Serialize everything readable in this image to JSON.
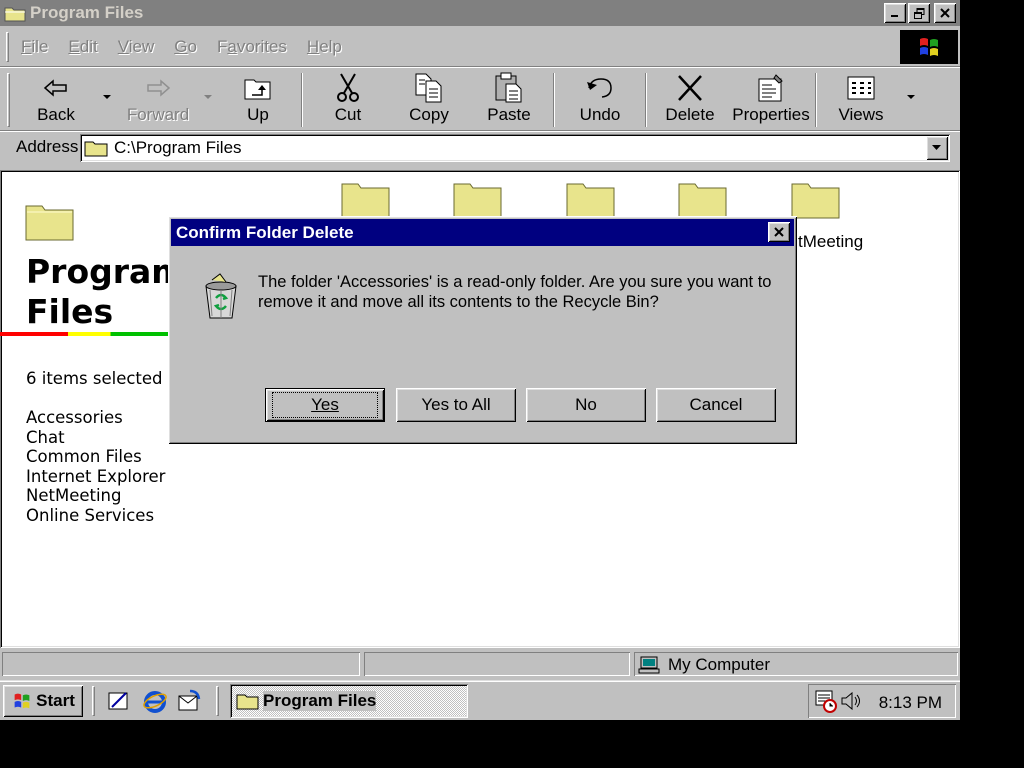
{
  "window": {
    "title": "Program Files"
  },
  "menu": [
    {
      "label": "File",
      "key": "F",
      "rest": "ile"
    },
    {
      "label": "Edit",
      "key": "E",
      "rest": "dit"
    },
    {
      "label": "View",
      "key": "V",
      "rest": "iew"
    },
    {
      "label": "Go",
      "key": "G",
      "rest": "o"
    },
    {
      "label": "Favorites",
      "key": "a",
      "pre": "F",
      "rest": "vorites"
    },
    {
      "label": "Help",
      "key": "H",
      "rest": "elp"
    }
  ],
  "toolbar": {
    "back": "Back",
    "forward": "Forward",
    "up": "Up",
    "cut": "Cut",
    "copy": "Copy",
    "paste": "Paste",
    "undo": "Undo",
    "delete": "Delete",
    "properties": "Properties",
    "views": "Views"
  },
  "address": {
    "label": "Address",
    "value": "C:\\Program Files"
  },
  "content": {
    "folder_title": "Program\nFiles",
    "selected_count": "6 items selected",
    "items": [
      "Accessories",
      "Chat",
      "Common Files",
      "Internet Explorer",
      "NetMeeting",
      "Online Services"
    ],
    "visible_icon_label": "tMeeting"
  },
  "statusbar": {
    "computer": "My Computer"
  },
  "taskbar": {
    "start": "Start",
    "task": "Program Files",
    "clock": "8:13 PM"
  },
  "dialog": {
    "title": "Confirm Folder Delete",
    "message": "The folder 'Accessories' is a read-only folder. Are you sure you want to remove it and move all its contents to the Recycle Bin?",
    "yes": "Yes",
    "yes_to_all": "Yes to All",
    "no": "No",
    "cancel": "Cancel"
  },
  "colors": {
    "dialog_title": "#000080",
    "folder": "#e8e48c",
    "desktop": "#c0c0c0"
  }
}
